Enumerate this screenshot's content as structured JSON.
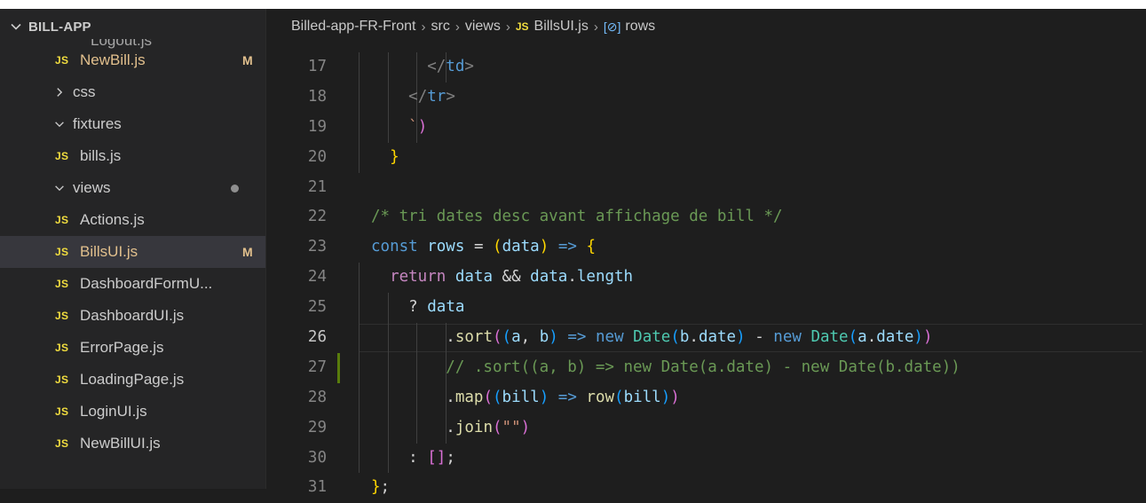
{
  "explorer": {
    "title": "BILL-APP",
    "cut_item": "Logout.js",
    "items": [
      {
        "type": "file",
        "name": "NewBill.js",
        "badge": "M",
        "modified": true
      },
      {
        "type": "folder",
        "name": "css",
        "expanded": false
      },
      {
        "type": "folder",
        "name": "fixtures",
        "expanded": true
      },
      {
        "type": "file",
        "name": "bills.js"
      },
      {
        "type": "folder",
        "name": "views",
        "expanded": true,
        "dot": true
      },
      {
        "type": "file",
        "name": "Actions.js"
      },
      {
        "type": "file",
        "name": "BillsUI.js",
        "badge": "M",
        "modified": true,
        "selected": true
      },
      {
        "type": "file",
        "name": "DashboardFormU..."
      },
      {
        "type": "file",
        "name": "DashboardUI.js"
      },
      {
        "type": "file",
        "name": "ErrorPage.js"
      },
      {
        "type": "file",
        "name": "LoadingPage.js"
      },
      {
        "type": "file",
        "name": "LoginUI.js"
      },
      {
        "type": "file",
        "name": "NewBillUI.js"
      }
    ],
    "file_icon_label": "JS"
  },
  "breadcrumb": {
    "parts": [
      "Billed-app-FR-Front",
      "src",
      "views"
    ],
    "file": "BillsUI.js",
    "file_icon_label": "JS",
    "symbol": "rows",
    "symbol_icon": "[⊘]"
  },
  "editor": {
    "current_line": 26,
    "modified_line": 27,
    "lines": [
      {
        "n": "17",
        "text": "      </td>"
      },
      {
        "n": "18",
        "text": "    </tr>"
      },
      {
        "n": "19",
        "text": "    `)"
      },
      {
        "n": "20",
        "text": "  }"
      },
      {
        "n": "21",
        "text": ""
      },
      {
        "n": "22",
        "text": "/* tri dates desc avant affichage de bill */"
      },
      {
        "n": "23",
        "text": "const rows = (data) => {"
      },
      {
        "n": "24",
        "text": "  return data && data.length"
      },
      {
        "n": "25",
        "text": "    ? data"
      },
      {
        "n": "26",
        "text": "        .sort((a, b) => new Date(b.date) - new Date(a.date))"
      },
      {
        "n": "27",
        "text": "        // .sort((a, b) => new Date(a.date) - new Date(b.date))"
      },
      {
        "n": "28",
        "text": "        .map((bill) => row(bill))"
      },
      {
        "n": "29",
        "text": "        .join(\"\")"
      },
      {
        "n": "30",
        "text": "    : [];"
      },
      {
        "n": "31",
        "text": "};"
      }
    ]
  },
  "colors": {
    "sidebar_bg": "#252526",
    "editor_bg": "#1e1e1e",
    "js_icon": "#f1dd3f",
    "modified": "#e2c08d",
    "keyword": "#569cd6",
    "control": "#c586c0",
    "function": "#dcdcaa",
    "variable": "#9cdcfe",
    "comment": "#6a9955",
    "string": "#ce9178"
  }
}
